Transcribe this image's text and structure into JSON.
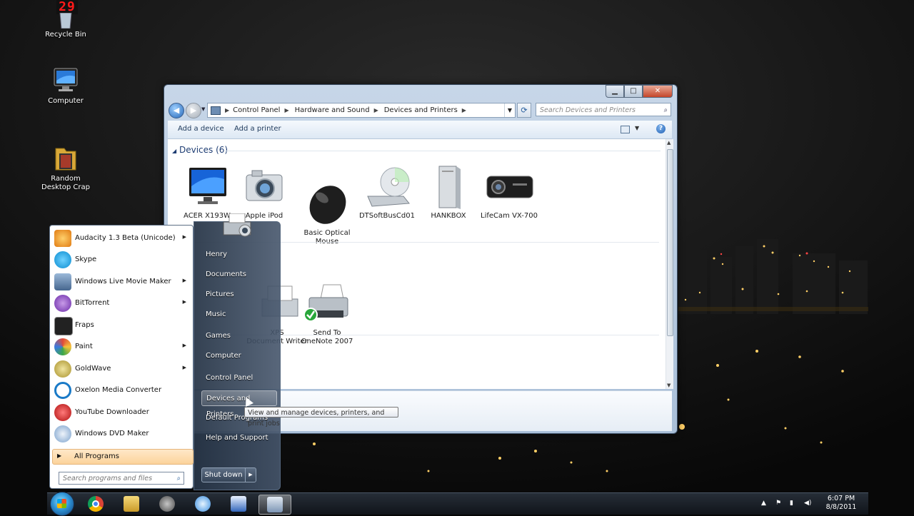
{
  "desktop": {
    "counter": "29",
    "icons": [
      {
        "label": "Recycle Bin",
        "icon": "recycle-bin-icon"
      },
      {
        "label": "Computer",
        "icon": "computer-icon"
      },
      {
        "label": "Random\nDesktop Crap",
        "icon": "folder-icon"
      }
    ]
  },
  "explorer": {
    "breadcrumb": [
      "Control Panel",
      "Hardware and Sound",
      "Devices and Printers"
    ],
    "search_placeholder": "Search Devices and Printers",
    "commands": {
      "add_device": "Add a device",
      "add_printer": "Add a printer"
    },
    "devices_group": "Devices (6)",
    "devices": [
      {
        "label": "ACER X193W",
        "icon": "monitor-icon"
      },
      {
        "label": "Apple iPod",
        "icon": "camera-icon"
      },
      {
        "label": "Basic Optical\nMouse",
        "icon": "mouse-icon"
      },
      {
        "label": "DTSoftBusCd01",
        "icon": "cd-drive-icon"
      },
      {
        "label": "HANKBOX",
        "icon": "tower-pc-icon"
      },
      {
        "label": "LifeCam VX-700",
        "icon": "webcam-icon"
      }
    ],
    "printers": [
      {
        "label": "XPS\nDocument Writer",
        "icon": "printer-icon"
      },
      {
        "label": "Send To\nOneNote 2007",
        "icon": "printer-icon",
        "default": true
      }
    ]
  },
  "start_menu": {
    "programs": [
      {
        "label": "Audacity 1.3 Beta (Unicode)",
        "submenu": true,
        "color": "#f2a63a"
      },
      {
        "label": "Skype",
        "submenu": false,
        "color": "#14a8e6"
      },
      {
        "label": "Windows Live Movie Maker",
        "submenu": true,
        "color": "#5a7ea8"
      },
      {
        "label": "BitTorrent",
        "submenu": true,
        "color": "#7a3fb5"
      },
      {
        "label": "Fraps",
        "submenu": false,
        "color": "#e0c400"
      },
      {
        "label": "Paint",
        "submenu": true,
        "color": "#e88c3c"
      },
      {
        "label": "GoldWave",
        "submenu": true,
        "color": "#c8a93c"
      },
      {
        "label": "Oxelon Media Converter",
        "submenu": false,
        "color": "#1a7ac7"
      },
      {
        "label": "YouTube Downloader",
        "submenu": false,
        "color": "#c41b1b"
      },
      {
        "label": "Windows DVD Maker",
        "submenu": false,
        "color": "#5a8ec8"
      }
    ],
    "all_programs": "All Programs",
    "search_placeholder": "Search programs and files",
    "right_items": [
      "Henry",
      "Documents",
      "Pictures",
      "Music",
      "Games",
      "Computer",
      "Control Panel",
      "Devices and Printers",
      "Default Programs",
      "Help and Support"
    ],
    "highlighted": "Devices and Printers",
    "shutdown": "Shut down",
    "tooltip": "View and manage devices, printers, and print jobs"
  },
  "taskbar": {
    "apps": [
      "chrome-icon",
      "explorer-folder-icon",
      "steam-icon",
      "itunes-icon",
      "word-icon",
      "devices-printers-icon"
    ],
    "time": "6:07 PM",
    "date": "8/8/2011"
  }
}
